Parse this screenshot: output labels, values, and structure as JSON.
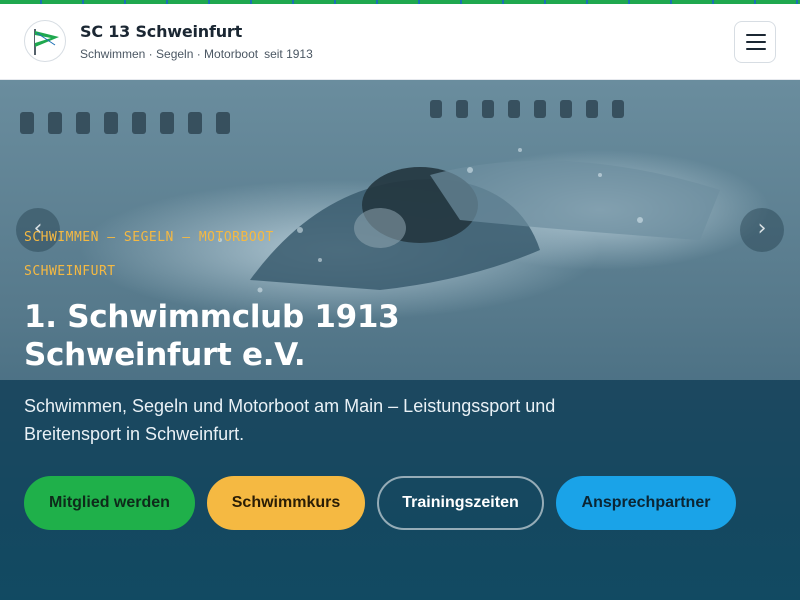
{
  "header": {
    "title": "SC 13 Schweinfurt",
    "subtitle": "Schwimmen · Segeln · Motorboot",
    "since": "seit 1913",
    "menu_icon": "hamburger-menu-icon",
    "logo_icon": "club-pennant-logo"
  },
  "hero": {
    "kicker_1": "SCHWIMMEN – SEGELN – MOTORBOOT",
    "kicker_2": "SCHWEINFURT",
    "title_line_1": "1. Schwimmclub 1913",
    "title_line_2": "Schweinfurt e.V.",
    "description": "Schwimmen, Segeln und Motorboot am Main – Leistungssport und Breitensport in Schweinfurt.",
    "prev_arrow": "‹",
    "next_arrow": "›"
  },
  "buttons": {
    "member": "Mitglied werden",
    "course": "Schwimmkurs",
    "training": "Trainingszeiten",
    "contact": "Ansprechpartner"
  },
  "colors": {
    "accent_green": "#1fb04a",
    "accent_yellow": "#f5b942",
    "accent_blue": "#1aa3e8",
    "hero_overlay": "#0f3b57"
  }
}
